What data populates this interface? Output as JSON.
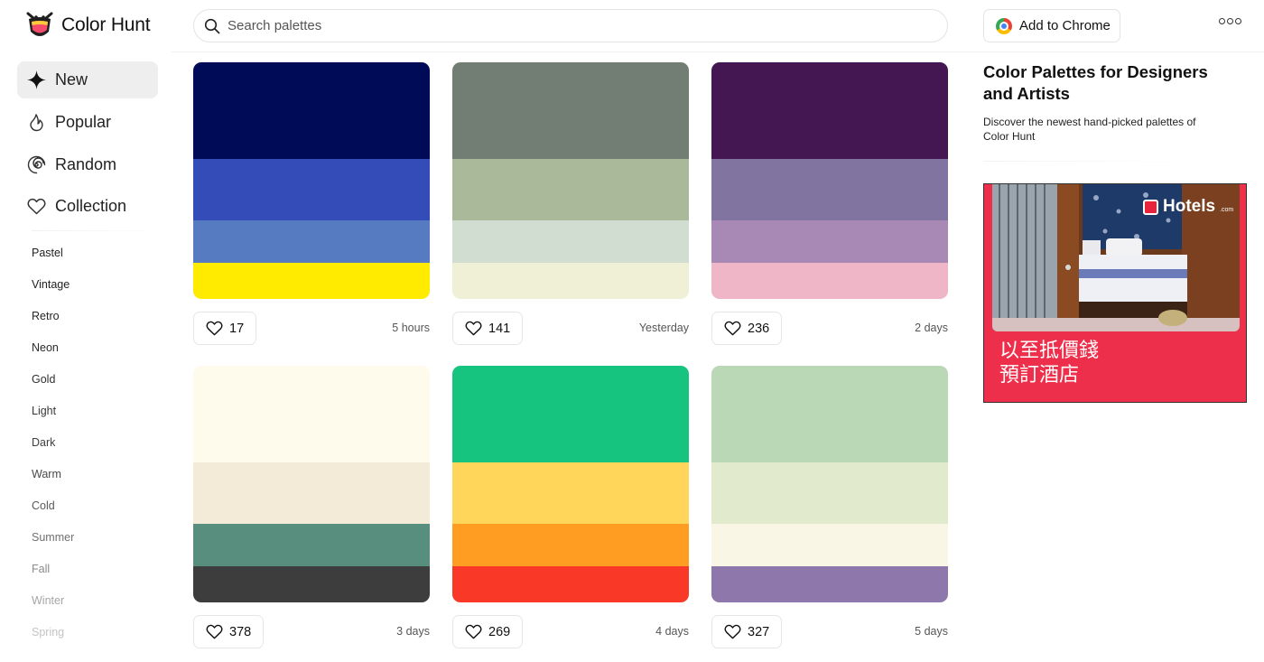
{
  "brand": {
    "name": "Color Hunt"
  },
  "search": {
    "placeholder": "Search palettes"
  },
  "header": {
    "chrome_label": "Add to Chrome"
  },
  "nav": [
    {
      "label": "New",
      "icon": "sparkle-icon",
      "active": true
    },
    {
      "label": "Popular",
      "icon": "flame-icon",
      "active": false
    },
    {
      "label": "Random",
      "icon": "spiral-icon",
      "active": false
    },
    {
      "label": "Collection",
      "icon": "heart-icon",
      "active": false
    }
  ],
  "tags": [
    "Pastel",
    "Vintage",
    "Retro",
    "Neon",
    "Gold",
    "Light",
    "Dark",
    "Warm",
    "Cold",
    "Summer",
    "Fall",
    "Winter",
    "Spring"
  ],
  "palettes": [
    {
      "colors": [
        "#000B58",
        "#344CB7",
        "#577BC1",
        "#FFEB00"
      ],
      "likes": "17",
      "time": "5 hours"
    },
    {
      "colors": [
        "#727D73",
        "#AAB99A",
        "#D0DDD0",
        "#F0F0D7"
      ],
      "likes": "141",
      "time": "Yesterday"
    },
    {
      "colors": [
        "#441752",
        "#8174A0",
        "#A888B5",
        "#EFB6C8"
      ],
      "likes": "236",
      "time": "2 days"
    },
    {
      "colors": [
        "#FEFAEC",
        "#F3EBD8",
        "#578E7E",
        "#3D3D3D"
      ],
      "likes": "378",
      "time": "3 days"
    },
    {
      "colors": [
        "#16C47F",
        "#FFD65A",
        "#FF9D23",
        "#F93827"
      ],
      "likes": "269",
      "time": "4 days"
    },
    {
      "colors": [
        "#BAD8B6",
        "#E1EACD",
        "#F9F6E6",
        "#8D77AB"
      ],
      "likes": "327",
      "time": "5 days"
    }
  ],
  "right_panel": {
    "title": "Color Palettes for Designers and Artists",
    "description": "Discover the newest hand-picked palettes of Color Hunt"
  },
  "ad": {
    "brand": "Hotels",
    "brand_suffix": ".com",
    "line1": "以至抵價錢",
    "line2": "預訂酒店"
  },
  "colors": {
    "accent_ad": "#EE2F4C",
    "active_nav_bg": "#EEEEEE"
  }
}
